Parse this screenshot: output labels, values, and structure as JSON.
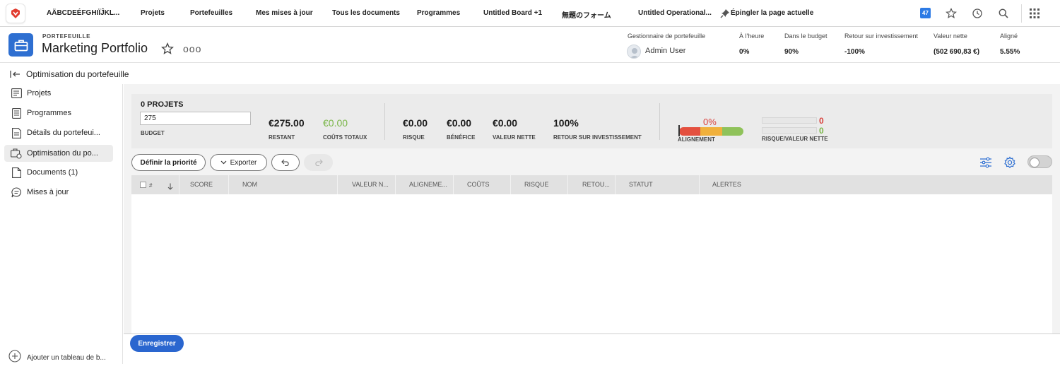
{
  "topnav": {
    "items": [
      "AÄBCDEÉFGHIÏĴKL...",
      "Projets",
      "Portefeuilles",
      "Mes mises à jour",
      "Tous les documents",
      "Programmes",
      "Untitled Board +1",
      "無題のフォーム",
      "Untitled Operational...",
      "Épingler la page actuelle"
    ],
    "notification_count": "47",
    "icons": [
      "favorites-star-icon",
      "history-clock-icon",
      "search-icon",
      "apps-grid-icon"
    ],
    "brand_color": "#e13c2f"
  },
  "header": {
    "kicker": "PORTEFEUILLE",
    "title": "Marketing Portfolio",
    "more": "ooo",
    "stats": [
      {
        "label": "Gestionnaire de portefeuille",
        "value": "Admin User"
      },
      {
        "label": "À l'heure",
        "value": "0%"
      },
      {
        "label": "Dans le budget",
        "value": "90%"
      },
      {
        "label": "Retour sur investissement",
        "value": "-100%"
      },
      {
        "label": "Valeur nette",
        "value": "(502 690,83 €)"
      },
      {
        "label": "Aligné",
        "value": "5.55%"
      }
    ]
  },
  "subheader": {
    "title": "Optimisation du portefeuille"
  },
  "sidebar": {
    "items": [
      {
        "label": "Projets",
        "icon": "projects-icon"
      },
      {
        "label": "Programmes",
        "icon": "programs-icon"
      },
      {
        "label": "Détails du portefeui...",
        "icon": "details-icon"
      },
      {
        "label": "Optimisation du po...",
        "icon": "optimization-icon",
        "active": true
      },
      {
        "label": "Documents (1)",
        "icon": "document-icon"
      },
      {
        "label": "Mises à jour",
        "icon": "updates-icon"
      }
    ],
    "add_label": "Ajouter un tableau de b..."
  },
  "summary": {
    "count": "0 PROJETS",
    "budget_value": "275",
    "budget_label": "BUDGET",
    "remaining": {
      "value": "€275.00",
      "label": "RESTANT"
    },
    "total_costs": {
      "value": "€0.00",
      "label": "COÛTS TOTAUX"
    },
    "risk": {
      "value": "€0.00",
      "label": "RISQUE"
    },
    "benefit": {
      "value": "€0.00",
      "label": "BÉNÉFICE"
    },
    "net_value": {
      "value": "€0.00",
      "label": "VALEUR NETTE"
    },
    "roi": {
      "value": "100%",
      "label": "RETOUR SUR INVESTISSEMENT"
    },
    "alignment": {
      "value": "0%",
      "label": "ALIGNEMENT",
      "level": 0
    },
    "risk_net": {
      "risk": "0",
      "net": "0",
      "label": "RISQUE/VALEUR NETTE"
    },
    "colors": {
      "green": "#7ab648",
      "red": "#d9413c",
      "orange": "#f0b03c",
      "bar_red": "#e4503f",
      "bar_green": "#8fc25a"
    }
  },
  "toolbar": {
    "prioritize": "Définir la priorité",
    "export": "Exporter",
    "undo_icon": "undo-icon",
    "redo_icon": "redo-icon"
  },
  "grid": {
    "columns": [
      "#",
      "SCORE",
      "NOM",
      "VALEUR N...",
      "ALIGNEME...",
      "COÛTS",
      "RISQUE",
      "RETOU...",
      "STATUT",
      "ALERTES"
    ],
    "rows": []
  },
  "footer": {
    "save": "Enregistrer"
  }
}
